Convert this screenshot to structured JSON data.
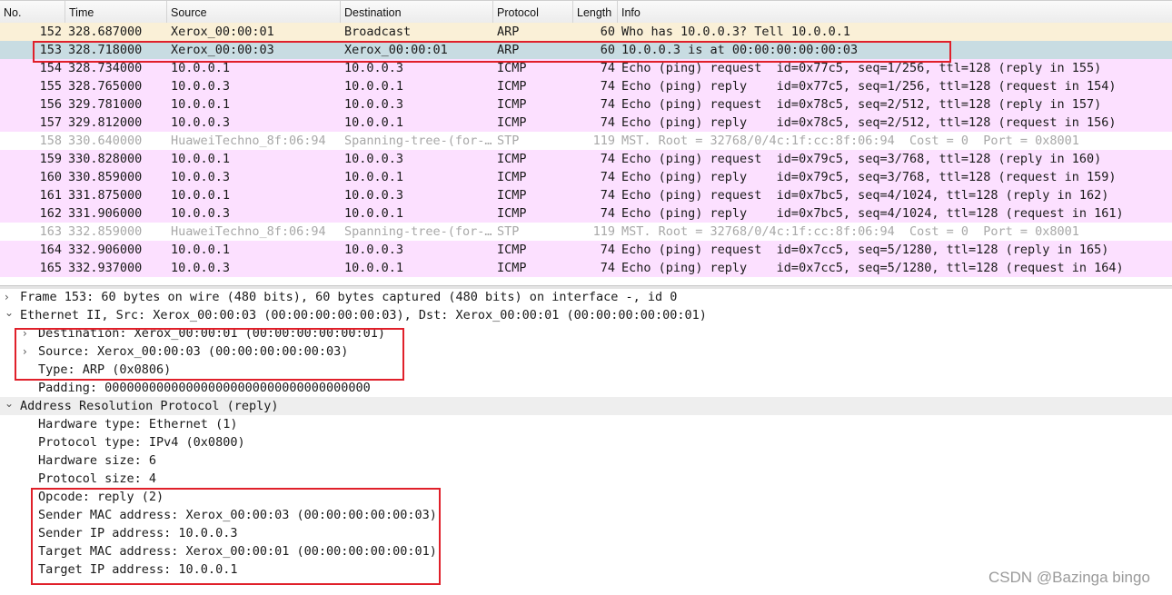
{
  "colors": {
    "arp": "#faf0d7",
    "icmp": "#fce0ff",
    "stp": "#ffffff",
    "selected": "#c8dce2",
    "highlight_box": "#e0202a"
  },
  "columns": [
    "No.",
    "Time",
    "Source",
    "Destination",
    "Protocol",
    "Length",
    "Info"
  ],
  "packets": [
    {
      "no": "152",
      "time": "328.687000",
      "src": "Xerox_00:00:01",
      "dst": "Broadcast",
      "proto": "ARP",
      "len": "60",
      "info": "Who has 10.0.0.3? Tell 10.0.0.1",
      "kind": "arp"
    },
    {
      "no": "153",
      "time": "328.718000",
      "src": "Xerox_00:00:03",
      "dst": "Xerox_00:00:01",
      "proto": "ARP",
      "len": "60",
      "info": "10.0.0.3 is at 00:00:00:00:00:03",
      "kind": "selected"
    },
    {
      "no": "154",
      "time": "328.734000",
      "src": "10.0.0.1",
      "dst": "10.0.0.3",
      "proto": "ICMP",
      "len": "74",
      "info": "Echo (ping) request  id=0x77c5, seq=1/256, ttl=128 (reply in 155)",
      "kind": "icmp"
    },
    {
      "no": "155",
      "time": "328.765000",
      "src": "10.0.0.3",
      "dst": "10.0.0.1",
      "proto": "ICMP",
      "len": "74",
      "info": "Echo (ping) reply    id=0x77c5, seq=1/256, ttl=128 (request in 154)",
      "kind": "icmp"
    },
    {
      "no": "156",
      "time": "329.781000",
      "src": "10.0.0.1",
      "dst": "10.0.0.3",
      "proto": "ICMP",
      "len": "74",
      "info": "Echo (ping) request  id=0x78c5, seq=2/512, ttl=128 (reply in 157)",
      "kind": "icmp"
    },
    {
      "no": "157",
      "time": "329.812000",
      "src": "10.0.0.3",
      "dst": "10.0.0.1",
      "proto": "ICMP",
      "len": "74",
      "info": "Echo (ping) reply    id=0x78c5, seq=2/512, ttl=128 (request in 156)",
      "kind": "icmp"
    },
    {
      "no": "158",
      "time": "330.640000",
      "src": "HuaweiTechno_8f:06:94",
      "dst": "Spanning-tree-(for-…",
      "proto": "STP",
      "len": "119",
      "info": "MST. Root = 32768/0/4c:1f:cc:8f:06:94  Cost = 0  Port = 0x8001",
      "kind": "stp"
    },
    {
      "no": "159",
      "time": "330.828000",
      "src": "10.0.0.1",
      "dst": "10.0.0.3",
      "proto": "ICMP",
      "len": "74",
      "info": "Echo (ping) request  id=0x79c5, seq=3/768, ttl=128 (reply in 160)",
      "kind": "icmp"
    },
    {
      "no": "160",
      "time": "330.859000",
      "src": "10.0.0.3",
      "dst": "10.0.0.1",
      "proto": "ICMP",
      "len": "74",
      "info": "Echo (ping) reply    id=0x79c5, seq=3/768, ttl=128 (request in 159)",
      "kind": "icmp"
    },
    {
      "no": "161",
      "time": "331.875000",
      "src": "10.0.0.1",
      "dst": "10.0.0.3",
      "proto": "ICMP",
      "len": "74",
      "info": "Echo (ping) request  id=0x7bc5, seq=4/1024, ttl=128 (reply in 162)",
      "kind": "icmp"
    },
    {
      "no": "162",
      "time": "331.906000",
      "src": "10.0.0.3",
      "dst": "10.0.0.1",
      "proto": "ICMP",
      "len": "74",
      "info": "Echo (ping) reply    id=0x7bc5, seq=4/1024, ttl=128 (request in 161)",
      "kind": "icmp"
    },
    {
      "no": "163",
      "time": "332.859000",
      "src": "HuaweiTechno_8f:06:94",
      "dst": "Spanning-tree-(for-…",
      "proto": "STP",
      "len": "119",
      "info": "MST. Root = 32768/0/4c:1f:cc:8f:06:94  Cost = 0  Port = 0x8001",
      "kind": "stp"
    },
    {
      "no": "164",
      "time": "332.906000",
      "src": "10.0.0.1",
      "dst": "10.0.0.3",
      "proto": "ICMP",
      "len": "74",
      "info": "Echo (ping) request  id=0x7cc5, seq=5/1280, ttl=128 (reply in 165)",
      "kind": "icmp"
    },
    {
      "no": "165",
      "time": "332.937000",
      "src": "10.0.0.3",
      "dst": "10.0.0.1",
      "proto": "ICMP",
      "len": "74",
      "info": "Echo (ping) reply    id=0x7cc5, seq=5/1280, ttl=128 (request in 164)",
      "kind": "icmp"
    }
  ],
  "details": [
    {
      "arrow": "collapsed",
      "indent": 0,
      "text": "Frame 153: 60 bytes on wire (480 bits), 60 bytes captured (480 bits) on interface -, id 0"
    },
    {
      "arrow": "expanded",
      "indent": 0,
      "text": "Ethernet II, Src: Xerox_00:00:03 (00:00:00:00:00:03), Dst: Xerox_00:00:01 (00:00:00:00:00:01)"
    },
    {
      "arrow": "collapsed",
      "indent": 1,
      "text": "Destination: Xerox_00:00:01 (00:00:00:00:00:01)"
    },
    {
      "arrow": "collapsed",
      "indent": 1,
      "text": "Source: Xerox_00:00:03 (00:00:00:00:00:03)"
    },
    {
      "arrow": "none",
      "indent": 1,
      "text": "Type: ARP (0x0806)"
    },
    {
      "arrow": "none",
      "indent": 1,
      "text": "Padding: 000000000000000000000000000000000000"
    },
    {
      "arrow": "expanded",
      "indent": 0,
      "text": "Address Resolution Protocol (reply)",
      "selected": true
    },
    {
      "arrow": "none",
      "indent": 1,
      "text": "Hardware type: Ethernet (1)"
    },
    {
      "arrow": "none",
      "indent": 1,
      "text": "Protocol type: IPv4 (0x0800)"
    },
    {
      "arrow": "none",
      "indent": 1,
      "text": "Hardware size: 6"
    },
    {
      "arrow": "none",
      "indent": 1,
      "text": "Protocol size: 4"
    },
    {
      "arrow": "none",
      "indent": 1,
      "text": "Opcode: reply (2)"
    },
    {
      "arrow": "none",
      "indent": 1,
      "text": "Sender MAC address: Xerox_00:00:03 (00:00:00:00:00:03)"
    },
    {
      "arrow": "none",
      "indent": 1,
      "text": "Sender IP address: 10.0.0.3"
    },
    {
      "arrow": "none",
      "indent": 1,
      "text": "Target MAC address: Xerox_00:00:01 (00:00:00:00:00:01)"
    },
    {
      "arrow": "none",
      "indent": 1,
      "text": "Target IP address: 10.0.0.1"
    }
  ],
  "watermark": "CSDN @Bazinga bingo"
}
